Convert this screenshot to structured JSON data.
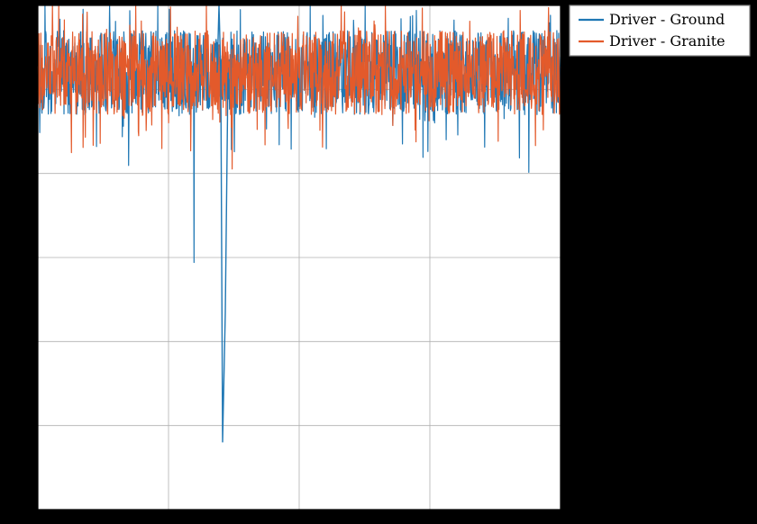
{
  "chart_data": {
    "type": "line",
    "series": [
      {
        "name": "Driver - Ground",
        "color": "#1f77b4"
      },
      {
        "name": "Driver - Granite",
        "color": "#e35a2b"
      }
    ],
    "xlabel": "",
    "ylabel": "",
    "xlim": [
      0,
      1000
    ],
    "ylim": [
      -0.5,
      0.1
    ],
    "x_gridlines": 4,
    "y_gridlines": 6,
    "noise_band": {
      "mean": 0.02,
      "amplitude": 0.05
    },
    "anomaly": {
      "x_frac": 0.35,
      "high": 0.1,
      "low": -0.42,
      "series_index": 0
    }
  },
  "legend": {
    "items": [
      {
        "label": "Driver - Ground",
        "color": "#1f77b4"
      },
      {
        "label": "Driver - Granite",
        "color": "#e35a2b"
      }
    ]
  }
}
